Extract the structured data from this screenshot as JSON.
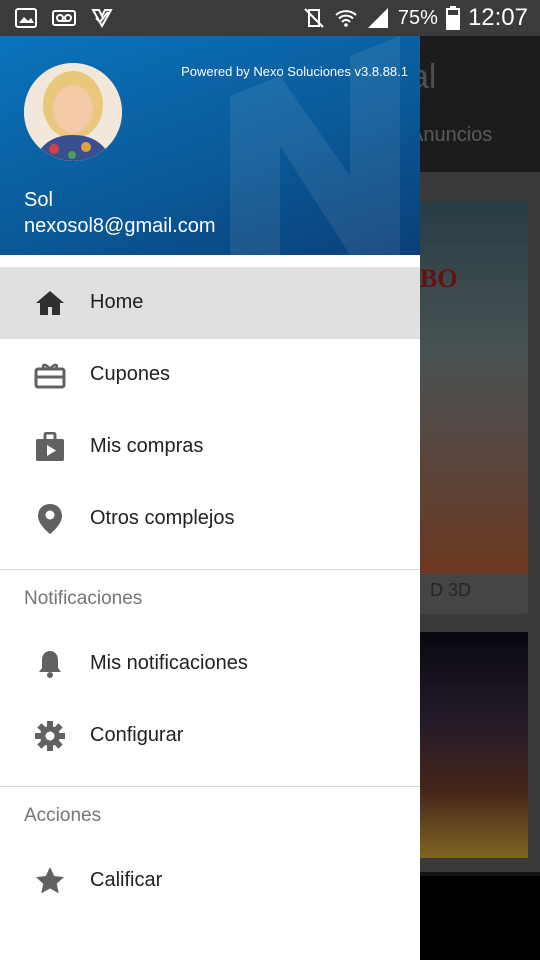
{
  "status_bar": {
    "battery": "75%",
    "time": "12:07"
  },
  "background": {
    "title": "al",
    "tab": "Anuncios",
    "poster_title": "BO",
    "card_caption": "D 3D"
  },
  "drawer": {
    "powered_by": "Powered by Nexo Soluciones v3.8.88.1",
    "user_name": "Sol",
    "user_email": "nexosol8@gmail.com",
    "items": [
      {
        "label": "Home",
        "icon": "home-icon"
      },
      {
        "label": "Cupones",
        "icon": "coupon-icon"
      },
      {
        "label": "Mis compras",
        "icon": "shopping-bag-icon"
      },
      {
        "label": "Otros complejos",
        "icon": "location-pin-icon"
      }
    ],
    "section_notificaciones": "Notificaciones",
    "notif_items": [
      {
        "label": "Mis notificaciones",
        "icon": "bell-icon"
      },
      {
        "label": "Configurar",
        "icon": "gear-icon"
      }
    ],
    "section_acciones": "Acciones",
    "action_items": [
      {
        "label": "Calificar",
        "icon": "star-icon"
      }
    ]
  },
  "colors": {
    "header_blue": "#0a6bb0",
    "active_item_bg": "#e0e0e0",
    "icon_gray": "#616161"
  }
}
